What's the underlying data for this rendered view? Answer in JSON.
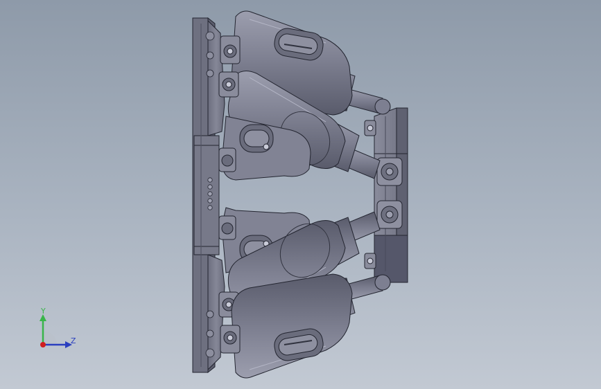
{
  "viewport": {
    "background_top": "#8e9aa9",
    "background_bottom": "#c2c9d3"
  },
  "model": {
    "body_color": "#7d7f91",
    "shadow_color": "#575a6a",
    "highlight_color": "#a6a8b8",
    "edge_color": "#232530"
  },
  "triad": {
    "y_label": "Y",
    "z_label": "Z",
    "y_color": "#39b54a",
    "z_color": "#2a3fbf",
    "x_color": "#d01f1f"
  }
}
